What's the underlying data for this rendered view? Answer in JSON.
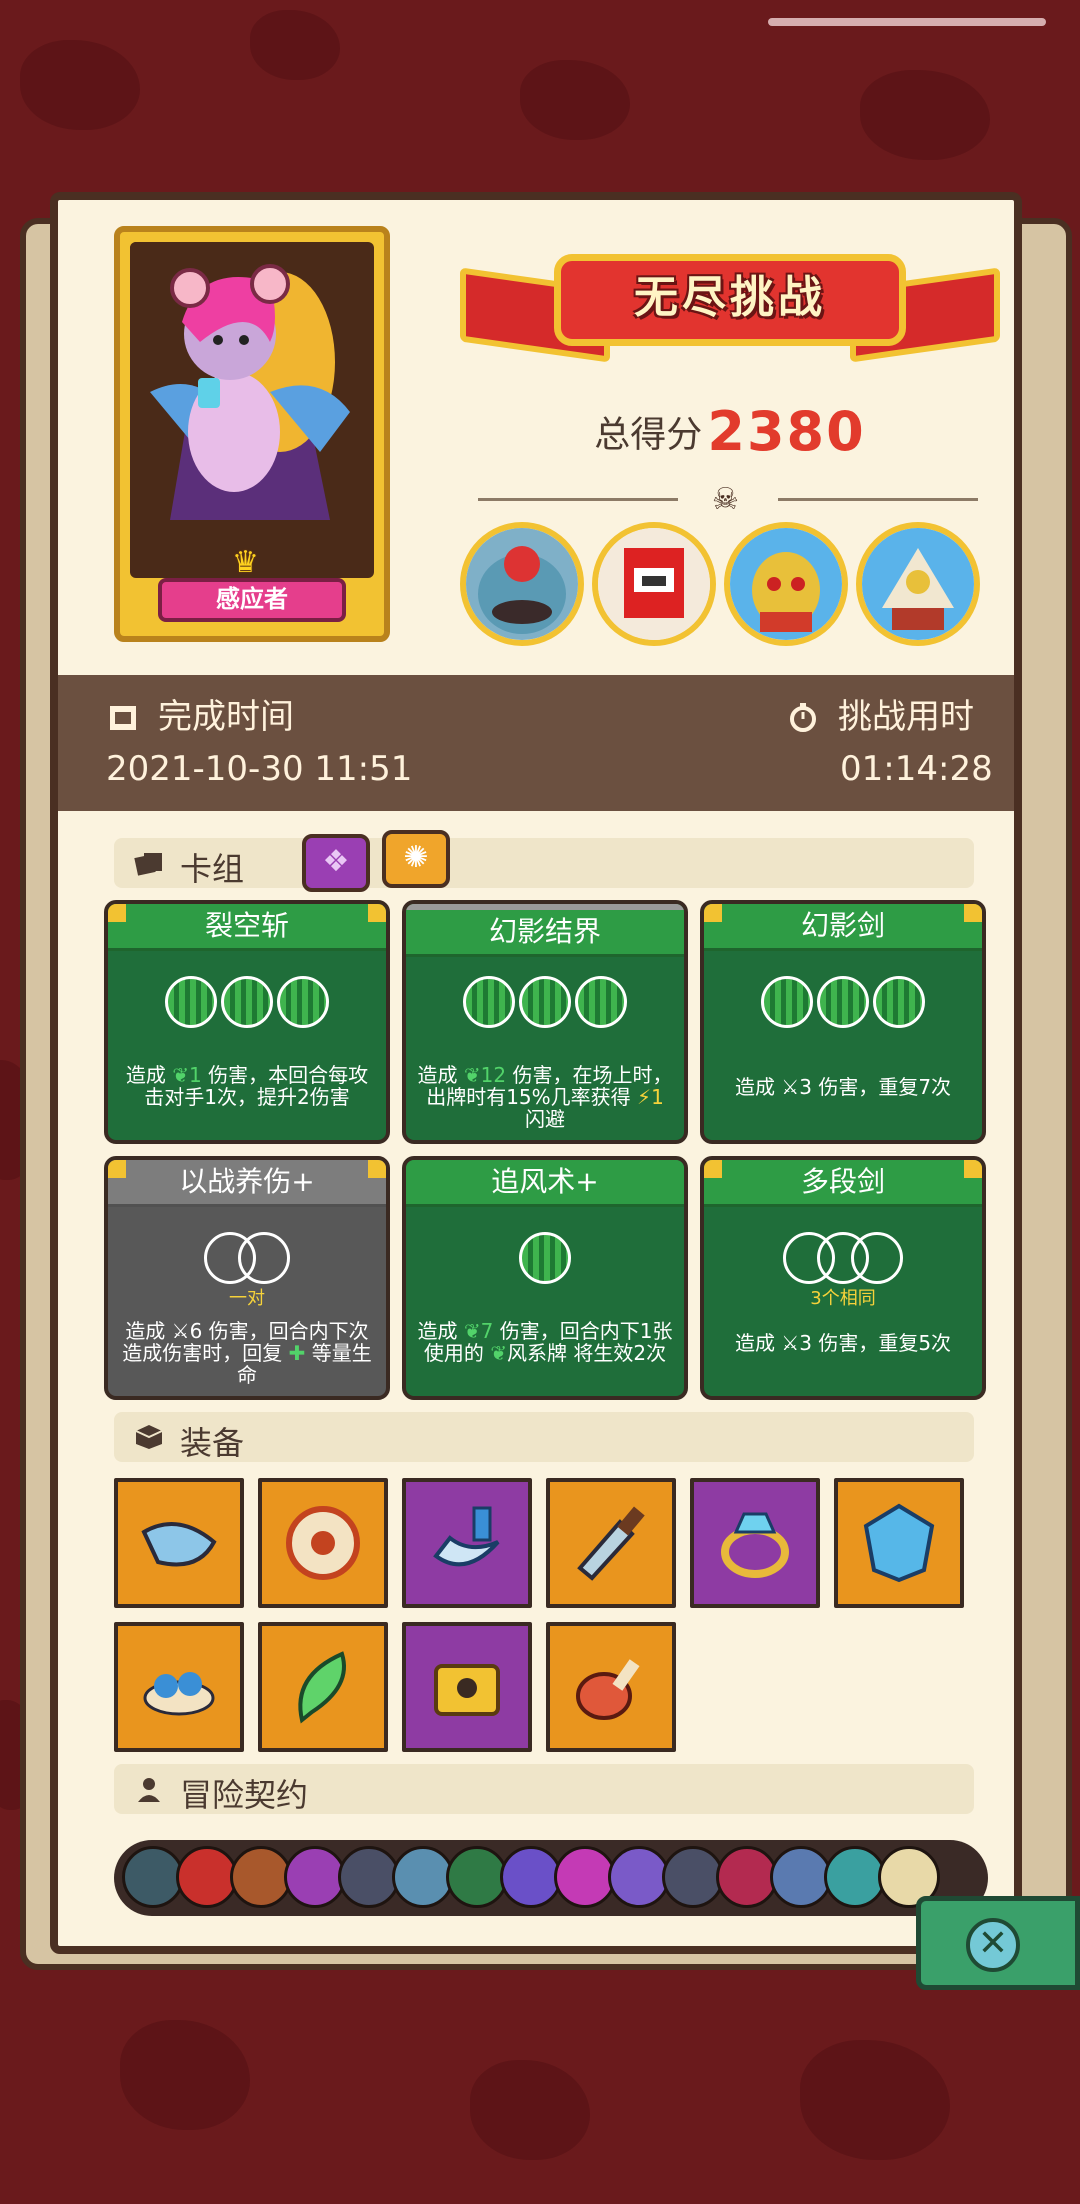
{
  "hero": {
    "name": "感应者"
  },
  "header": {
    "title": "无尽挑战",
    "score_label": "总得分",
    "score_value": "2380"
  },
  "times": {
    "completed_label": "完成时间",
    "completed_value": "2021-10-30 11:51",
    "duration_label": "挑战用时",
    "duration_value": "01:14:28"
  },
  "deck": {
    "label": "卡组",
    "cards": [
      {
        "name": "裂空斩",
        "desc_a": "造成 ",
        "desc_n": "1",
        "desc_b": " 伤害，本回合每攻击对手1次，提升2伤害"
      },
      {
        "name": "幻影结界",
        "desc_a": "造成 ",
        "desc_n": "12",
        "desc_b": " 伤害，在场上时，出牌时有15%几率获得 ",
        "desc_n2": "1",
        "desc_c": " 闪避"
      },
      {
        "name": "幻影剑",
        "desc": "造成 ⚔3 伤害，重复7次"
      },
      {
        "name": "以战养伤+",
        "note": "一对",
        "desc_a": "造成 ⚔6 伤害，回合内下次造成伤害时，回复 ",
        "desc_b": " 等量生命"
      },
      {
        "name": "追风术+",
        "desc_a": "造成 ",
        "desc_n": "7",
        "desc_b": " 伤害，回合内下1张使用的 ",
        "desc_c": "风系牌 将生效2次"
      },
      {
        "name": "多段剑",
        "note": "3个相同",
        "desc": "造成 ⚔3 伤害，重复5次"
      }
    ]
  },
  "equipment": {
    "label": "装备"
  },
  "contracts": {
    "label": "冒险契约"
  },
  "colors": {
    "accent": "#e23b2c",
    "card_green": "#2e9c45",
    "orange_slot": "#e9951e",
    "purple_slot": "#8e3ba3"
  }
}
